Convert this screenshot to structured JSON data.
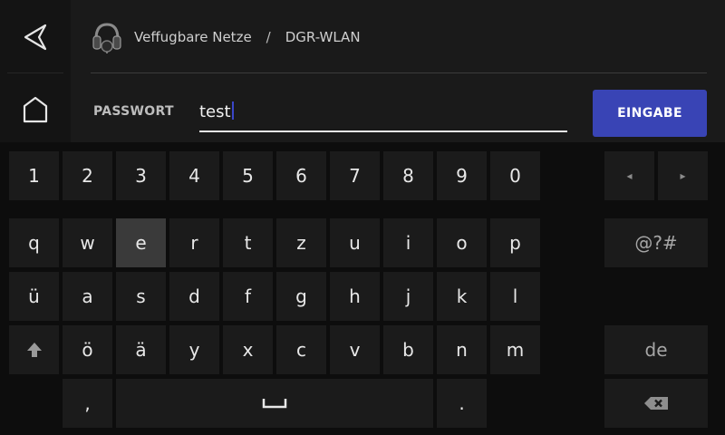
{
  "sidebar": {
    "back_icon": "back-arrow-icon",
    "home_icon": "home-icon"
  },
  "breadcrumb": {
    "icon": "headset-icon",
    "parent": "Veffugbare Netze",
    "separator": "/",
    "current": "DGR-WLAN"
  },
  "password": {
    "label": "PASSWORT",
    "value": "test"
  },
  "submit": {
    "label": "EINGABE"
  },
  "keyboard": {
    "row_numbers": [
      "1",
      "2",
      "3",
      "4",
      "5",
      "6",
      "7",
      "8",
      "9",
      "0"
    ],
    "row_1": [
      "q",
      "w",
      "e",
      "r",
      "t",
      "z",
      "u",
      "i",
      "o",
      "p"
    ],
    "row_2": [
      "ü",
      "a",
      "s",
      "d",
      "f",
      "g",
      "h",
      "j",
      "k",
      "l"
    ],
    "row_3": [
      "ö",
      "ä",
      "y",
      "x",
      "c",
      "v",
      "b",
      "n",
      "m"
    ],
    "row_4": {
      "comma": ",",
      "period": "."
    },
    "highlighted_key": "e",
    "cursor_left": "◂",
    "cursor_right": "▸",
    "symbols_label": "@?#",
    "language_label": "de",
    "shift_icon": "shift-arrow-icon",
    "space_icon": "space-bar-icon",
    "backspace_icon": "backspace-icon"
  },
  "colors": {
    "accent": "#3944b5",
    "key_bg": "#1b1b1b",
    "key_highlight": "#3a3a3a",
    "header_bg": "#1a1a1a"
  }
}
